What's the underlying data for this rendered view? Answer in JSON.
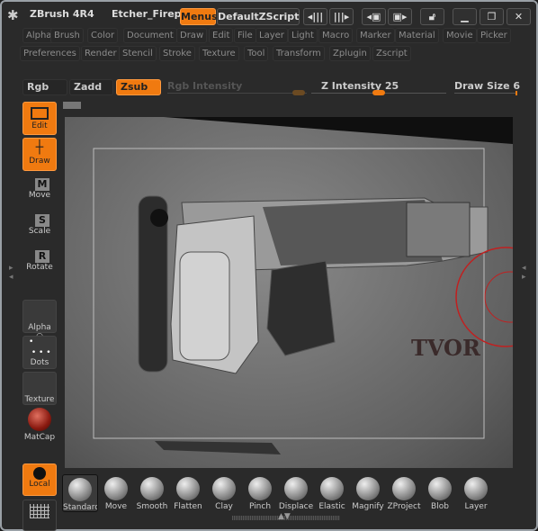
{
  "titlebar": {
    "app": "ZBrush 4R4",
    "document": "Etcher_Firep",
    "menus_button": "Menus",
    "script_button": "DefaultZScript"
  },
  "menus_row1": [
    "Alpha",
    "Brush",
    "Color",
    "Document",
    "Draw",
    "Edit",
    "File",
    "Layer",
    "Light",
    "Macro",
    "Marker",
    "Material",
    "Movie",
    "Picker"
  ],
  "menus_row2": [
    "Preferences",
    "Render",
    "Stencil",
    "Stroke",
    "Texture",
    "Tool",
    "Transform",
    "Zplugin",
    "Zscript"
  ],
  "draw_bar": {
    "rgb": "Rgb",
    "zadd": "Zadd",
    "zsub": "Zsub",
    "rgb_intensity": "Rgb Intensity",
    "z_intensity": "Z Intensity 25",
    "draw_size": "Draw Size 6",
    "z_intensity_value": 25,
    "draw_size_value": 6,
    "active_mode": "Zsub"
  },
  "left_tools": {
    "edit": "Edit",
    "draw": "Draw",
    "move": "Move",
    "move_key": "M",
    "scale": "Scale",
    "scale_key": "S",
    "rotate": "Rotate",
    "rotate_key": "R",
    "alpha": "Alpha",
    "dots": "Dots",
    "texture": "Texture",
    "matcap": "MatCap",
    "local": "Local"
  },
  "brushes": [
    "Standard",
    "Move",
    "Smooth",
    "Flatten",
    "Clay",
    "Pinch",
    "Displace",
    "Elastic",
    "Magnify",
    "ZProject",
    "Blob",
    "Layer"
  ],
  "watermark": "TVOR",
  "colors": {
    "accent": "#f07a10",
    "panel": "#2a2a2a",
    "canvas": "#6e6e6e"
  }
}
